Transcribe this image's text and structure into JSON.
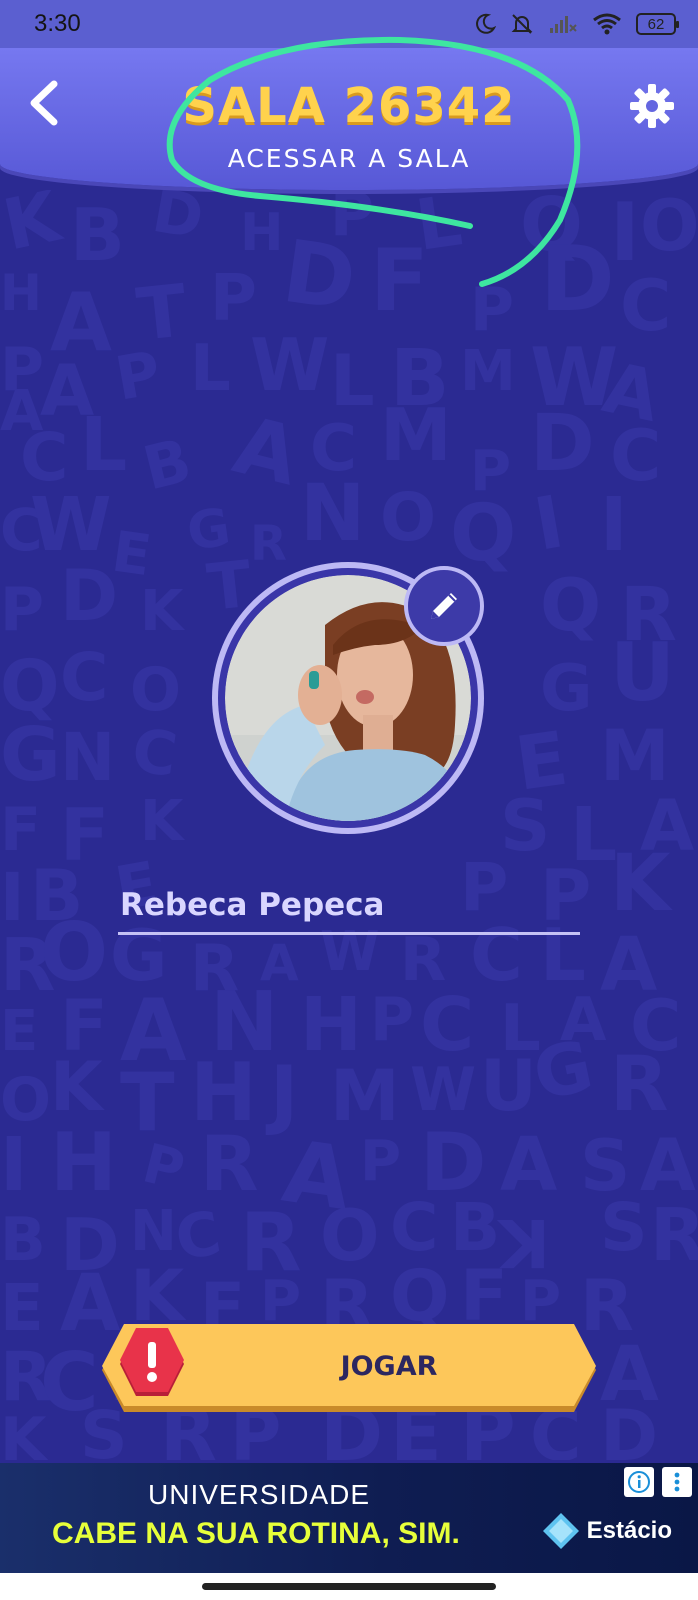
{
  "status_bar": {
    "time": "3:30",
    "battery": "62",
    "icons": [
      "moon-icon",
      "bell-off-icon",
      "signal-icon",
      "wifi-icon",
      "battery-icon"
    ]
  },
  "header": {
    "title": "SALA 26342",
    "subtitle": "ACESSAR A SALA",
    "back_icon": "chevron-left-icon",
    "settings_icon": "gear-icon"
  },
  "profile": {
    "name_value": "Rebeca Pepeca",
    "edit_icon": "pencil-icon"
  },
  "play_button": {
    "label": "JOGAR",
    "alert_icon": "exclamation-icon"
  },
  "ad": {
    "line1": "UNIVERSIDADE",
    "line2": "CABE NA SUA ROTINA, SIM.",
    "brand": "Estácio"
  },
  "colors": {
    "background": "#2b2a92",
    "header": "#6668e4",
    "title": "#ffd24d",
    "annotation": "#3ee6a0",
    "play_button": "#fdc75a",
    "alert": "#e8334a"
  }
}
